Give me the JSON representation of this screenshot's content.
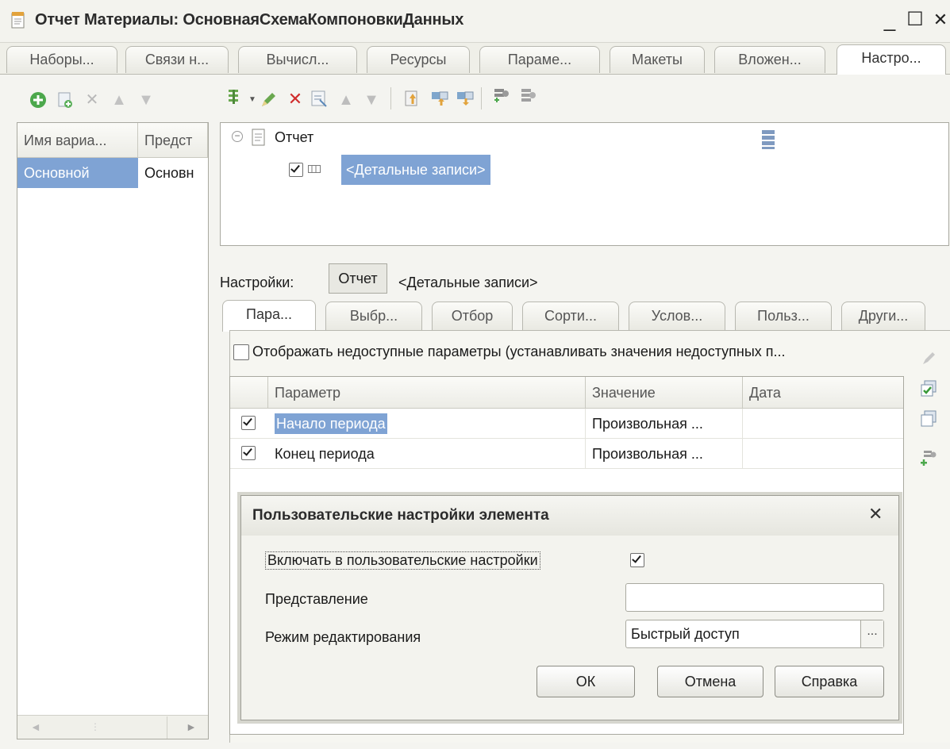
{
  "window": {
    "title": "Отчет Материалы: ОсновнаяСхемаКомпоновкиДанных",
    "minimize": "_",
    "maximize": "☐",
    "close": "✕"
  },
  "top_tabs": [
    "Наборы...",
    "Связи н...",
    "Вычисл...",
    "Ресурсы",
    "Параме...",
    "Макеты",
    "Вложен...",
    "Настро..."
  ],
  "variants": {
    "columns": [
      "Имя вариа...",
      "Предст"
    ],
    "row": [
      "Основной",
      "Основн"
    ],
    "scroll_left": "◄",
    "scroll_right": "►"
  },
  "tree": {
    "root": "Отчет",
    "child": "<Детальные записи>"
  },
  "settings": {
    "label": "Настройки:",
    "btn_report": "Отчет",
    "current": "<Детальные записи>"
  },
  "sub_tabs": [
    "Пара...",
    "Выбр...",
    "Отбор",
    "Сорти...",
    "Услов...",
    "Польз...",
    "Други..."
  ],
  "show_unavailable": "Отображать недоступные параметры (устанавливать значения недоступных п...",
  "params": {
    "columns": [
      "Параметр",
      "Значение",
      "Дата"
    ],
    "rows": [
      {
        "name": "Начало периода",
        "value": "Произвольная ...",
        "date": ""
      },
      {
        "name": "Конец периода",
        "value": "Произвольная ...",
        "date": ""
      }
    ]
  },
  "dialog": {
    "title": "Пользовательские настройки элемента",
    "close": "✕",
    "include_label": "Включать в пользовательские настройки",
    "presentation_label": "Представление",
    "presentation_value": "",
    "mode_label": "Режим редактирования",
    "mode_value": "Быстрый доступ",
    "mode_btn": "...",
    "ok": "ОК",
    "cancel": "Отмена",
    "help": "Справка"
  }
}
